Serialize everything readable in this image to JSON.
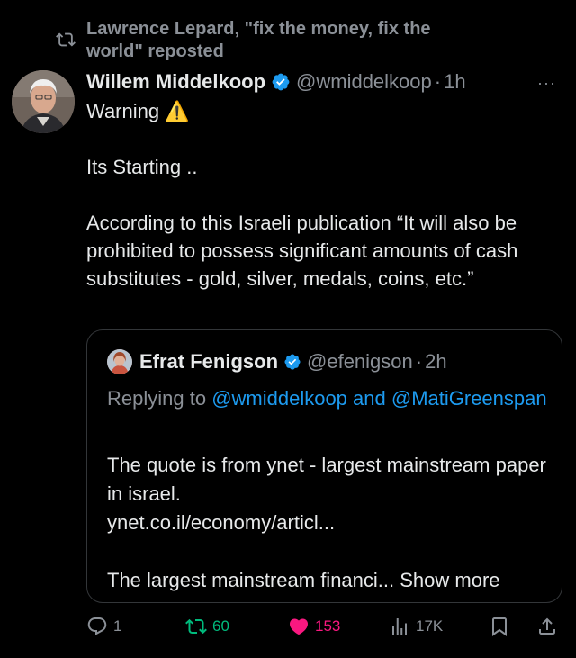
{
  "repost": {
    "text": "Lawrence Lepard, \"fix the money, fix the world\" reposted"
  },
  "tweet": {
    "author_name": "Willem Middelkoop",
    "handle": "@wmiddelkoop",
    "separator": "·",
    "time": "1h",
    "more": "···",
    "lines": [
      "Warning ⚠️",
      "",
      "Its Starting ..",
      "",
      "According to this Israeli publication “It will also be prohibited to possess significant amounts of cash substitutes - gold, silver, medals, coins, etc.”"
    ]
  },
  "quote": {
    "author_name": "Efrat Fenigson",
    "handle": "@efenigson",
    "separator": "·",
    "time": "2h",
    "replying_prefix": "Replying to ",
    "mention1": "@wmiddelkoop",
    "and": " and ",
    "mention2": "@MatiGreenspan",
    "body_line1": "The quote is from ynet - largest mainstream paper in israel.",
    "body_line2": "ynet.co.il/economy/articl...",
    "body_line3_text": "The largest mainstream financi... ",
    "show_more": "Show more"
  },
  "actions": {
    "replies": "1",
    "reposts": "60",
    "likes": "153",
    "views": "17K"
  },
  "colors": {
    "background": "#000000",
    "text": "#e7e9ea",
    "muted": "#8b9097",
    "link": "#1d9bf0",
    "repost_green": "#00ba7c",
    "like_pink": "#f91880",
    "verified_blue": "#1d9bf0",
    "warning_yellow": "#ffcc00"
  }
}
